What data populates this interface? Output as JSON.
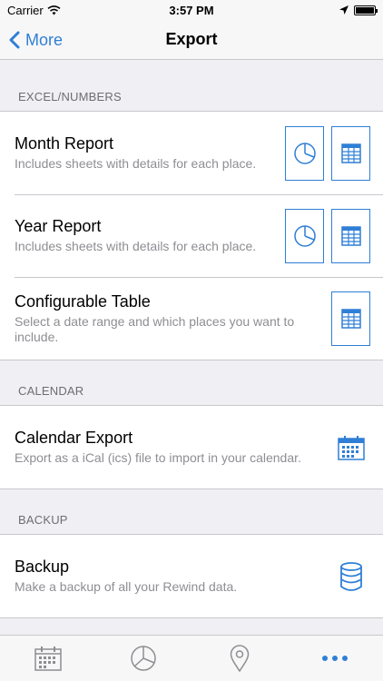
{
  "status_bar": {
    "carrier": "Carrier",
    "time": "3:57 PM"
  },
  "nav": {
    "back_label": "More",
    "title": "Export"
  },
  "sections": {
    "excel": {
      "header": "EXCEL/NUMBERS",
      "rows": [
        {
          "title": "Month Report",
          "subtitle": "Includes sheets with details for each place."
        },
        {
          "title": "Year Report",
          "subtitle": "Includes sheets with details for each place."
        },
        {
          "title": "Configurable Table",
          "subtitle": "Select a date range and which places you want to include."
        }
      ]
    },
    "calendar": {
      "header": "CALENDAR",
      "rows": [
        {
          "title": "Calendar Export",
          "subtitle": "Export as a iCal (ics) file to import in your calendar."
        }
      ]
    },
    "backup": {
      "header": "BACKUP",
      "rows": [
        {
          "title": "Backup",
          "subtitle": "Make a backup of all your Rewind data."
        }
      ]
    }
  },
  "tabs": [
    "calendar-tab",
    "chart-tab",
    "places-tab",
    "more-tab"
  ],
  "colors": {
    "accent": "#2f7fd6",
    "tab_inactive": "#8e8e93",
    "background": "#efeff4"
  }
}
